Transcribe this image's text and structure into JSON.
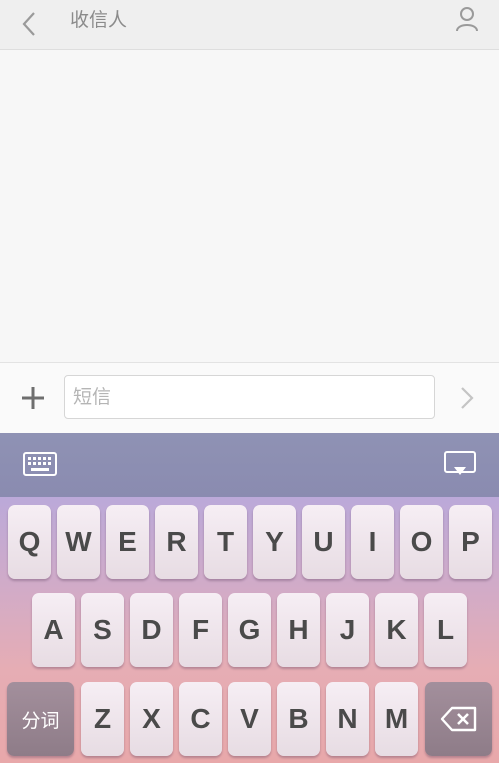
{
  "header": {
    "title": "收信人",
    "back_icon": "chevron-left-icon",
    "contact_icon": "person-icon"
  },
  "composer": {
    "add_icon": "plus-icon",
    "placeholder": "短信",
    "send_icon": "chevron-right-icon"
  },
  "keyboard_toolbar": {
    "left_icon": "keyboard-icon",
    "right_icon": "hide-keyboard-icon"
  },
  "keyboard": {
    "row1": [
      "Q",
      "W",
      "E",
      "R",
      "T",
      "Y",
      "U",
      "I",
      "O",
      "P"
    ],
    "row2": [
      "A",
      "S",
      "D",
      "F",
      "G",
      "H",
      "J",
      "K",
      "L"
    ],
    "row3": [
      "Z",
      "X",
      "C",
      "V",
      "B",
      "N",
      "M"
    ],
    "segment_label": "分词",
    "backspace_icon": "backspace-icon"
  },
  "colors": {
    "toolbar": "#8f92b4",
    "keyboard_top": "#bba9d9",
    "keyboard_bottom": "#e8a8aa",
    "key_face": "#f6eef4",
    "key_dark": "#9a8794"
  }
}
